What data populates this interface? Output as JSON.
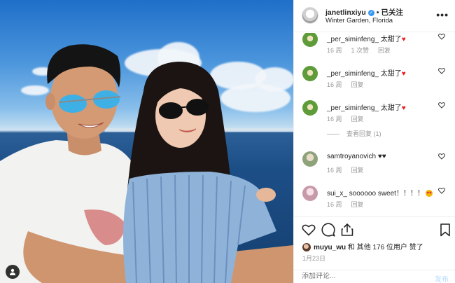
{
  "post": {
    "username": "janetlinxiyu",
    "follow_status": "已关注",
    "location": "Winter Garden, Florida",
    "more_label": "•••",
    "separator": "•"
  },
  "comments": [
    {
      "username": "_per_siminfeng_",
      "text": "太甜了",
      "time": "16 周",
      "likes": "1 次赞",
      "reply": "回复",
      "avatar_color": "#5e9c3a"
    },
    {
      "username": "_per_siminfeng_",
      "text": "太甜了",
      "time": "16 周",
      "likes": "",
      "reply": "回复",
      "avatar_color": "#5e9c3a"
    },
    {
      "username": "_per_siminfeng_",
      "text": "太甜了",
      "time": "16 周",
      "likes": "",
      "reply": "回复",
      "avatar_color": "#5e9c3a"
    },
    {
      "username": "samtroyanovich",
      "text": "♥♥",
      "time": "16 周",
      "likes": "",
      "reply": "回复",
      "avatar_color": "#a9b79a"
    },
    {
      "username": "sui_x_",
      "text": "soooooo sweet！！！！",
      "time": "16 周",
      "likes": "",
      "reply": "回复",
      "avatar_color": "#d9b8c7"
    }
  ],
  "view_replies": "查看回复 (1)",
  "likes": {
    "user": "muyu_wu",
    "text": " 和 其他 176 位用户 赞了"
  },
  "date": "1月23日",
  "add_comment": {
    "placeholder": "添加评论...",
    "post_label": "发布"
  },
  "colors": {
    "verified": "#3897f0",
    "heart_red": "#ed1c24",
    "meta_gray": "#999999"
  }
}
